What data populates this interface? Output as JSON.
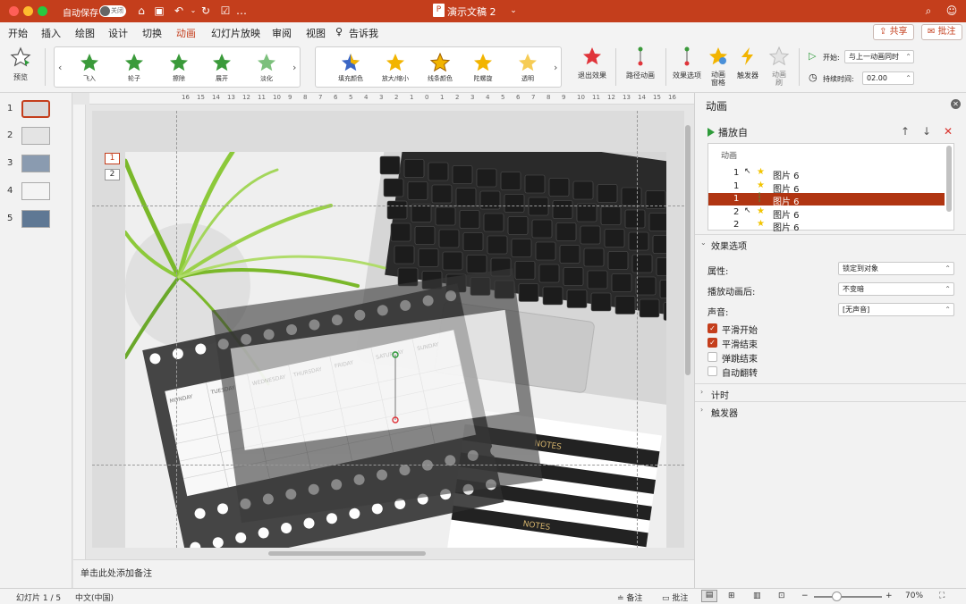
{
  "titlebar": {
    "autosave_label": "自动保存",
    "autosave_toggle": "关闭",
    "doc_title": "演示文稿 2",
    "accent": "#c43e1c"
  },
  "tabs": [
    "开始",
    "插入",
    "绘图",
    "设计",
    "切换",
    "动画",
    "幻灯片放映",
    "审阅",
    "视图"
  ],
  "tell_me": "告诉我",
  "share_label": "共享",
  "comment_label": "批注",
  "ribbon": {
    "preview_label": "预览",
    "entrance": [
      "飞入",
      "轮子",
      "擦除",
      "展开",
      "淡化"
    ],
    "emphasis": [
      "填充颜色",
      "放大/缩小",
      "线条颜色",
      "陀螺旋",
      "透明"
    ],
    "exit_label": "退出效果",
    "path_label": "路径动画",
    "effect_options_label": "效果选项",
    "anim_pane_label1": "动画",
    "anim_pane_label2": "窗格",
    "trigger_label": "触发器",
    "anim_brush_label1": "动画",
    "anim_brush_label2": "刷",
    "start_label": "开始:",
    "start_value": "与上一动画同时",
    "duration_label": "持续时间:",
    "duration_value": "02.00"
  },
  "slides": [
    "1",
    "2",
    "3",
    "4",
    "5"
  ],
  "canvas": {
    "tag1": "1",
    "tag2": "2",
    "calendar_days": [
      "MONDAY",
      "TUESDAY",
      "WEDNESDAY",
      "THURSDAY",
      "FRIDAY",
      "SATURDAY",
      "SUNDAY"
    ],
    "notes_text": "NOTES"
  },
  "ruler_numbers": [
    "16",
    "15",
    "14",
    "13",
    "12",
    "11",
    "10",
    "9",
    "8",
    "7",
    "6",
    "5",
    "4",
    "3",
    "2",
    "1",
    "0",
    "1",
    "2",
    "3",
    "4",
    "5",
    "6",
    "7",
    "8",
    "9",
    "10",
    "11",
    "12",
    "13",
    "14",
    "15",
    "16"
  ],
  "notes_placeholder": "单击此处添加备注",
  "pane": {
    "title": "动画",
    "play_from": "播放自",
    "list_header": "动画",
    "items": [
      {
        "order": "1",
        "label": "图片 6"
      },
      {
        "order": "1",
        "label": "图片 6"
      },
      {
        "order": "1",
        "label": "图片 6"
      },
      {
        "order": "2",
        "label": "图片 6"
      },
      {
        "order": "2",
        "label": "图片 6"
      }
    ],
    "effect_options_title": "效果选项",
    "prop_label": "属性:",
    "prop_value": "锁定到对象",
    "after_label": "播放动画后:",
    "after_value": "不变暗",
    "sound_label": "声音:",
    "sound_value": "[无声音]",
    "checks": [
      {
        "label": "平滑开始",
        "checked": true
      },
      {
        "label": "平滑结束",
        "checked": true
      },
      {
        "label": "弹跳结束",
        "checked": false
      },
      {
        "label": "自动翻转",
        "checked": false
      }
    ],
    "timing_title": "计时",
    "trigger_title": "触发器"
  },
  "status": {
    "slide_pos": "幻灯片 1 / 5",
    "language": "中文(中国)",
    "notes_label": "备注",
    "comments_label": "批注",
    "zoom": "70%"
  }
}
